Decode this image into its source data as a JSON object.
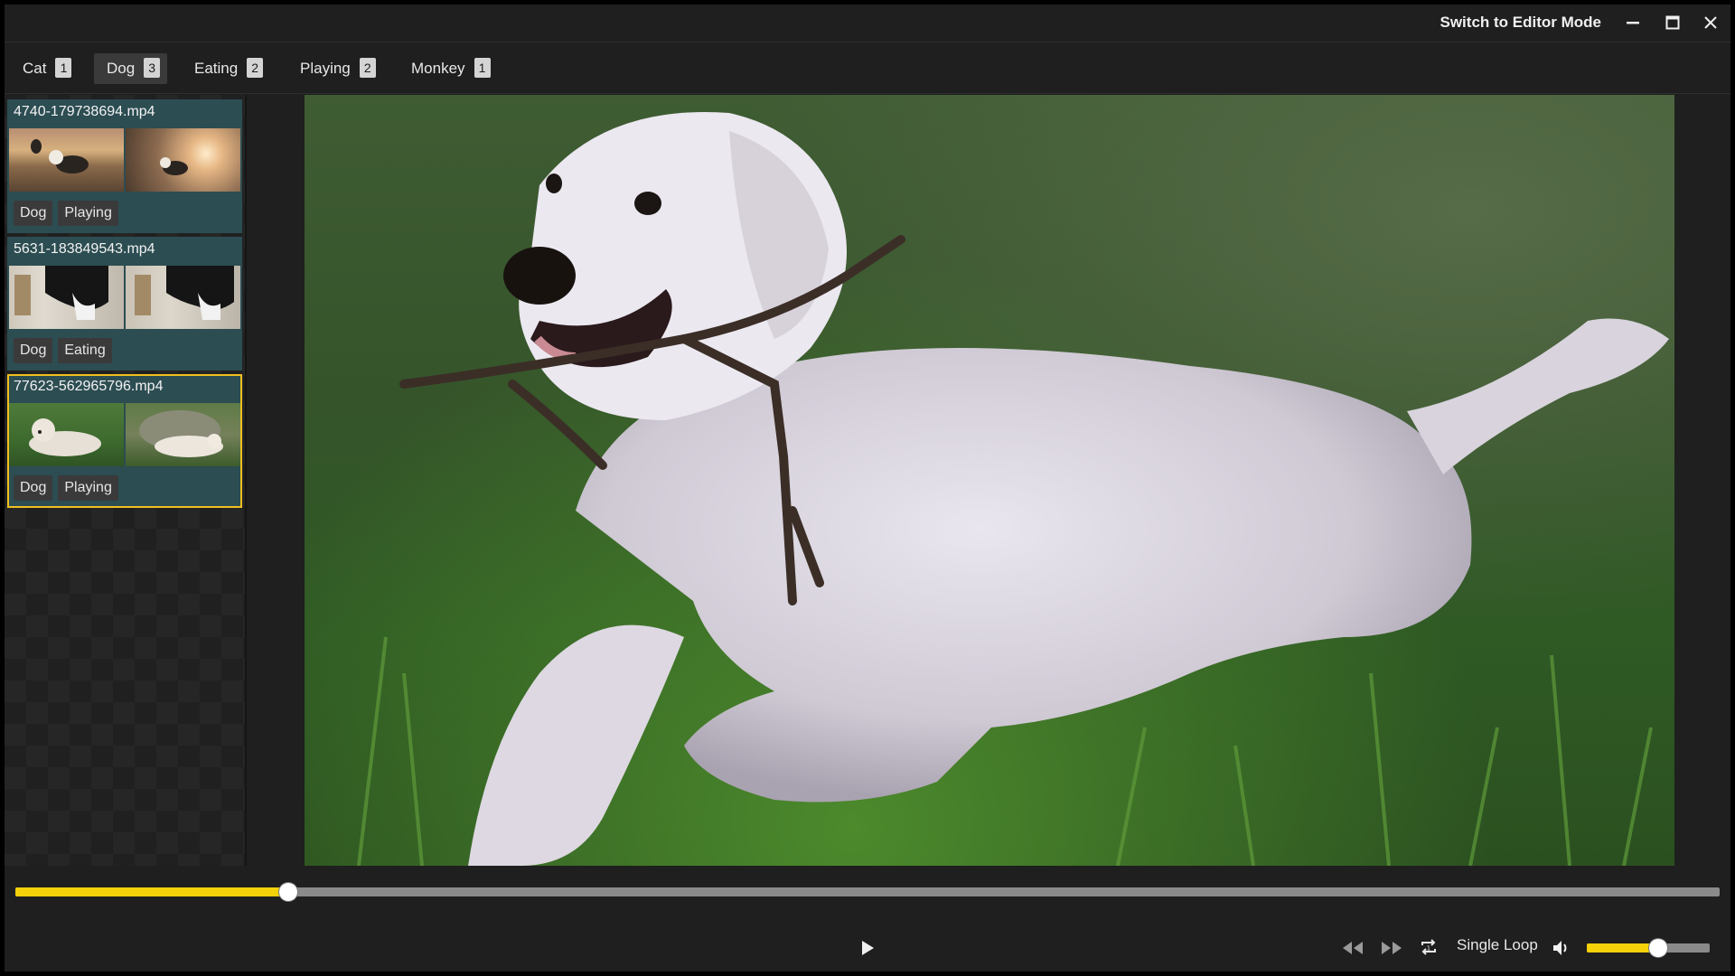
{
  "window": {
    "switch_mode_label": "Switch to Editor Mode",
    "buttons": [
      "minimize-icon",
      "maximize-icon",
      "close-icon"
    ]
  },
  "tabs": [
    {
      "label": "Cat",
      "count": "1",
      "active": false
    },
    {
      "label": "Dog",
      "count": "3",
      "active": true
    },
    {
      "label": "Eating",
      "count": "2",
      "active": false
    },
    {
      "label": "Playing",
      "count": "2",
      "active": false
    },
    {
      "label": "Monkey",
      "count": "1",
      "active": false
    }
  ],
  "videos": [
    {
      "filename": "4740-179738694.mp4",
      "tags": [
        "Dog",
        "Playing"
      ],
      "selected": false
    },
    {
      "filename": "5631-183849543.mp4",
      "tags": [
        "Dog",
        "Eating"
      ],
      "selected": false
    },
    {
      "filename": "77623-562965796.mp4",
      "tags": [
        "Dog",
        "Playing"
      ],
      "selected": true
    }
  ],
  "player": {
    "progress": 0.16,
    "volume": 0.58,
    "loop_mode": "Single Loop",
    "icons": [
      "play-icon",
      "rewind-icon",
      "fast-forward-icon",
      "loop-icon",
      "volume-icon"
    ]
  },
  "colors": {
    "accent": "#f5d10a",
    "card_bg": "#2c4d52",
    "selected_border": "#f0c020",
    "background": "#1f1f1f"
  }
}
